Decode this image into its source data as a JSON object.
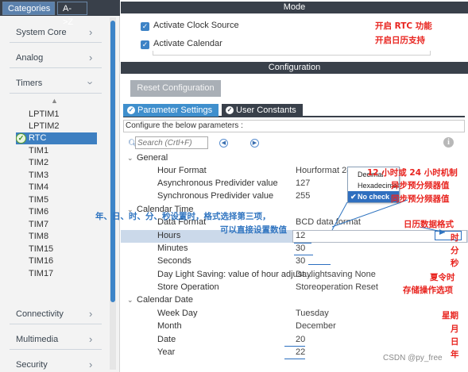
{
  "sidebar": {
    "tabs": [
      "Categories",
      "A->Z"
    ],
    "categories_top": [
      {
        "label": "System Core",
        "expanded": false
      },
      {
        "label": "Analog",
        "expanded": false
      },
      {
        "label": "Timers",
        "expanded": true
      }
    ],
    "timers": [
      "LPTIM1",
      "LPTIM2",
      "RTC",
      "TIM1",
      "TIM2",
      "TIM3",
      "TIM4",
      "TIM5",
      "TIM6",
      "TIM7",
      "TIM8",
      "TIM15",
      "TIM16",
      "TIM17"
    ],
    "selected_timer": "RTC",
    "categories_bottom": [
      {
        "label": "Connectivity"
      },
      {
        "label": "Multimedia"
      },
      {
        "label": "Security"
      }
    ]
  },
  "mode": {
    "header": "Mode",
    "options": [
      {
        "label": "Activate Clock Source",
        "checked": true
      },
      {
        "label": "Activate Calendar",
        "checked": true
      }
    ]
  },
  "configuration": {
    "header": "Configuration",
    "reset_label": "Reset Configuration",
    "tabs": [
      "Parameter Settings",
      "User Constants"
    ],
    "intro": "Configure the below parameters :",
    "search_placeholder": "Search (Crtl+F)",
    "groups": {
      "general": {
        "label": "General",
        "rows": [
          {
            "name": "Hour Format",
            "value": "Hourformat 24"
          },
          {
            "name": "Asynchronous Predivider value",
            "value": "127"
          },
          {
            "name": "Synchronous Predivider value",
            "value": "255"
          }
        ]
      },
      "calendar_time": {
        "label": "Calendar Time",
        "rows": [
          {
            "name": "Data Format",
            "value": "BCD data format"
          },
          {
            "name": "Hours",
            "value": "12"
          },
          {
            "name": "Minutes",
            "value": "30"
          },
          {
            "name": "Seconds",
            "value": "30"
          },
          {
            "name": "Day Light Saving: value of hour adjust...",
            "value": "Daylightsaving None"
          },
          {
            "name": "Store Operation",
            "value": "Storeoperation Reset"
          }
        ]
      },
      "calendar_date": {
        "label": "Calendar Date",
        "rows": [
          {
            "name": "Week Day",
            "value": "Tuesday"
          },
          {
            "name": "Month",
            "value": "December"
          },
          {
            "name": "Date",
            "value": "20"
          },
          {
            "name": "Year",
            "value": "22"
          }
        ]
      }
    },
    "dropdown": {
      "options": [
        "Decimal",
        "Hexadecimal",
        "No check"
      ],
      "selected": "No check"
    }
  },
  "annotations": {
    "rtc_func": "开启 RTC 功能",
    "calendar_support": "开启日历支持",
    "hour_fmt": "12 小时或 24 小时机制",
    "async_div": "异步预分频器值",
    "sync_div": "同步预分频器值",
    "set_time": "年、日、时、分、秒设置时，格式选择第三项，",
    "set_direct": "可以直接设置数值",
    "data_fmt": "日历数据格式",
    "hour": "时",
    "minute": "分",
    "second": "秒",
    "dst": "夏令时",
    "store_op": "存储操作选项",
    "week": "星期",
    "month": "月",
    "day": "日",
    "year": "年"
  },
  "watermark": "CSDN @py_free",
  "colors": {
    "accent": "#3f8fcd",
    "dark_bar": "#39404a",
    "annotation_red": "#e8241f",
    "annotation_blue": "#2f74c0"
  }
}
